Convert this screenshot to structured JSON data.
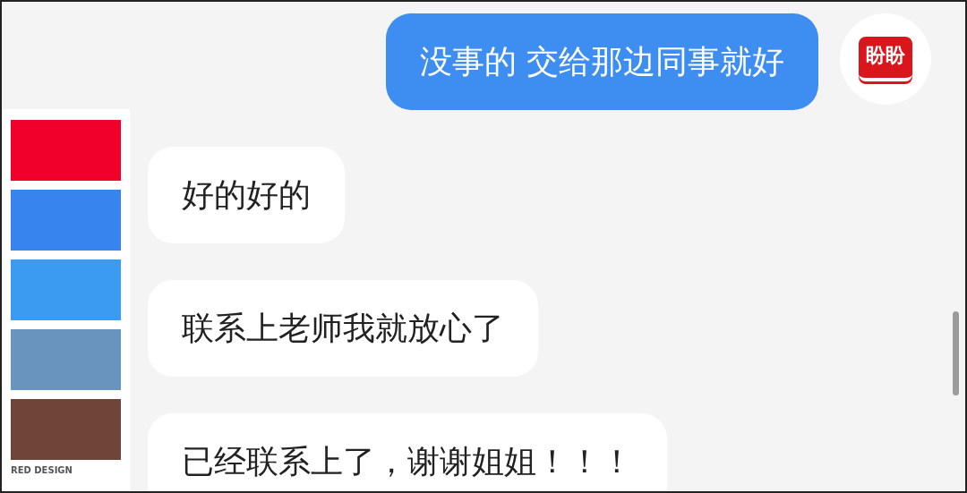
{
  "messages": [
    {
      "kind": "outgoing",
      "text": "没事的 交给那边同事就好",
      "avatar": "盼盼"
    },
    {
      "kind": "incoming",
      "text": "好的好的"
    },
    {
      "kind": "incoming",
      "text": "联系上老师我就放心了"
    },
    {
      "kind": "incoming",
      "text": "已经联系上了，谢谢姐姐！！！"
    }
  ],
  "palette": {
    "swatches": [
      {
        "color": "#f0002a"
      },
      {
        "color": "#3884ee"
      },
      {
        "color": "#3b9bf0"
      },
      {
        "color": "#6894bd"
      },
      {
        "color": "#6e4538"
      }
    ],
    "label": "RED DESIGN"
  }
}
